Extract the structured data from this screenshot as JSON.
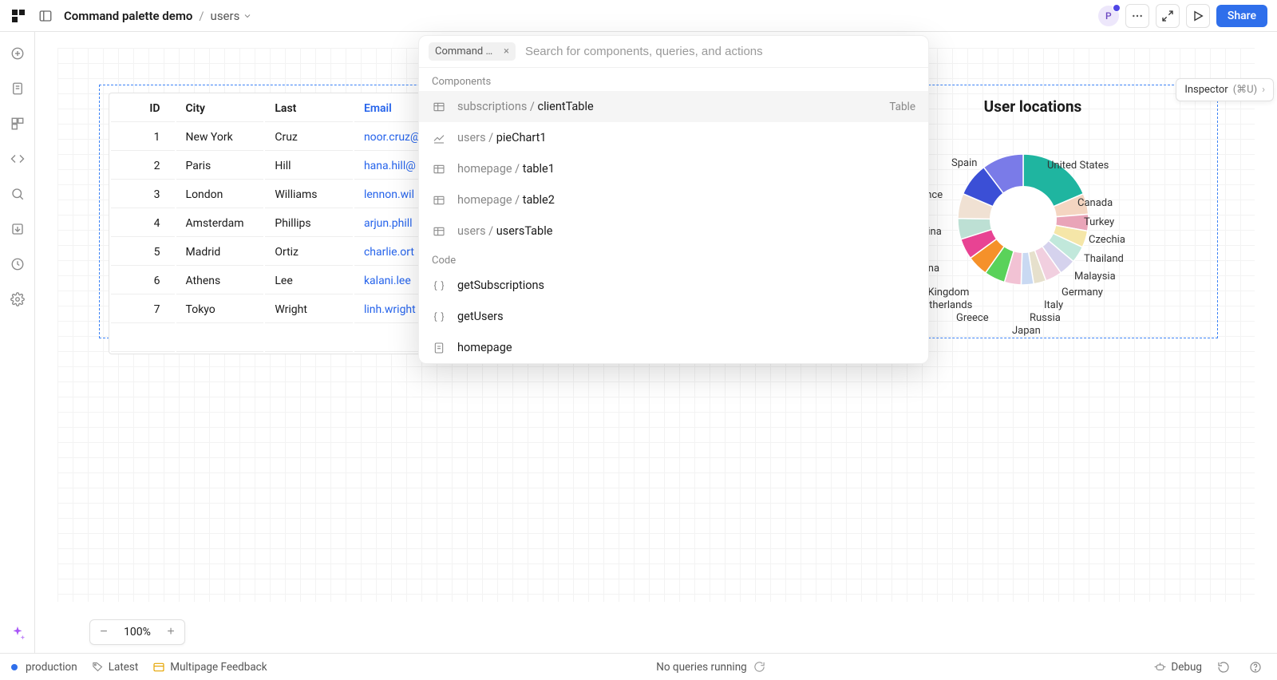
{
  "topbar": {
    "app_name": "Command palette demo",
    "page_name": "users",
    "share_label": "Share",
    "avatar_initial": "P"
  },
  "inspector": {
    "label": "Inspector",
    "shortcut": "(⌘U)"
  },
  "table": {
    "headers": {
      "id": "ID",
      "city": "City",
      "last": "Last",
      "email": "Email"
    },
    "rows": [
      {
        "id": "1",
        "city": "New York",
        "last": "Cruz",
        "email": "noor.cruz@"
      },
      {
        "id": "2",
        "city": "Paris",
        "last": "Hill",
        "email": "hana.hill@"
      },
      {
        "id": "3",
        "city": "London",
        "last": "Williams",
        "email": "lennon.wil"
      },
      {
        "id": "4",
        "city": "Amsterdam",
        "last": "Phillips",
        "email": "arjun.phill"
      },
      {
        "id": "5",
        "city": "Madrid",
        "last": "Ortiz",
        "email": "charlie.ort"
      },
      {
        "id": "6",
        "city": "Athens",
        "last": "Lee",
        "email": "kalani.lee"
      },
      {
        "id": "7",
        "city": "Tokyo",
        "last": "Wright",
        "email": "linh.wright"
      },
      {
        "id": "",
        "city": "",
        "last": "",
        "email": ""
      }
    ]
  },
  "chart_data": {
    "type": "pie",
    "title": "User locations",
    "series": [
      {
        "name": "United States",
        "value": 18,
        "color": "#1fb5a0"
      },
      {
        "name": "Canada",
        "value": 5,
        "color": "#f4d5c1"
      },
      {
        "name": "Turkey",
        "value": 4,
        "color": "#e9a4b8"
      },
      {
        "name": "Czechia",
        "value": 4,
        "color": "#f5e6a8"
      },
      {
        "name": "Thailand",
        "value": 4,
        "color": "#c1e8db"
      },
      {
        "name": "Malaysia",
        "value": 4,
        "color": "#d5d2ed"
      },
      {
        "name": "Germany",
        "value": 4,
        "color": "#f1cfdf"
      },
      {
        "name": "Italy",
        "value": 3,
        "color": "#e6e0cc"
      },
      {
        "name": "Russia",
        "value": 3,
        "color": "#c9d9f2"
      },
      {
        "name": "Japan",
        "value": 4,
        "color": "#f2c2d4"
      },
      {
        "name": "Greece",
        "value": 5,
        "color": "#5ad25a"
      },
      {
        "name": "Netherlands",
        "value": 5,
        "color": "#f5912a"
      },
      {
        "name": "United Kingdom",
        "value": 5,
        "color": "#e84393"
      },
      {
        "name": "China",
        "value": 5,
        "color": "#bde0d4"
      },
      {
        "name": "Argentina",
        "value": 6,
        "color": "#f0e1d3"
      },
      {
        "name": "France",
        "value": 8,
        "color": "#3b4fd6"
      },
      {
        "name": "Spain",
        "value": 10,
        "color": "#7a7be8"
      }
    ]
  },
  "palette": {
    "chip_label": "Command p…",
    "placeholder": "Search for components, queries, and actions",
    "sections": {
      "components": "Components",
      "code": "Code"
    },
    "components": [
      {
        "icon": "table",
        "prefix": "subscriptions / ",
        "name": "clientTable",
        "right": "Table",
        "hover": true
      },
      {
        "icon": "chart",
        "prefix": "users / ",
        "name": "pieChart1",
        "right": ""
      },
      {
        "icon": "table",
        "prefix": "homepage / ",
        "name": "table1",
        "right": ""
      },
      {
        "icon": "table",
        "prefix": "homepage / ",
        "name": "table2",
        "right": ""
      },
      {
        "icon": "table",
        "prefix": "users / ",
        "name": "usersTable",
        "right": ""
      }
    ],
    "code": [
      {
        "icon": "braces",
        "name": "getSubscriptions"
      },
      {
        "icon": "braces",
        "name": "getUsers"
      },
      {
        "icon": "page",
        "name": "homepage"
      }
    ]
  },
  "zoom": {
    "level": "100%"
  },
  "statusbar": {
    "env": "production",
    "tag": "Latest",
    "feedback": "Multipage Feedback",
    "center": "No queries running",
    "debug": "Debug"
  }
}
